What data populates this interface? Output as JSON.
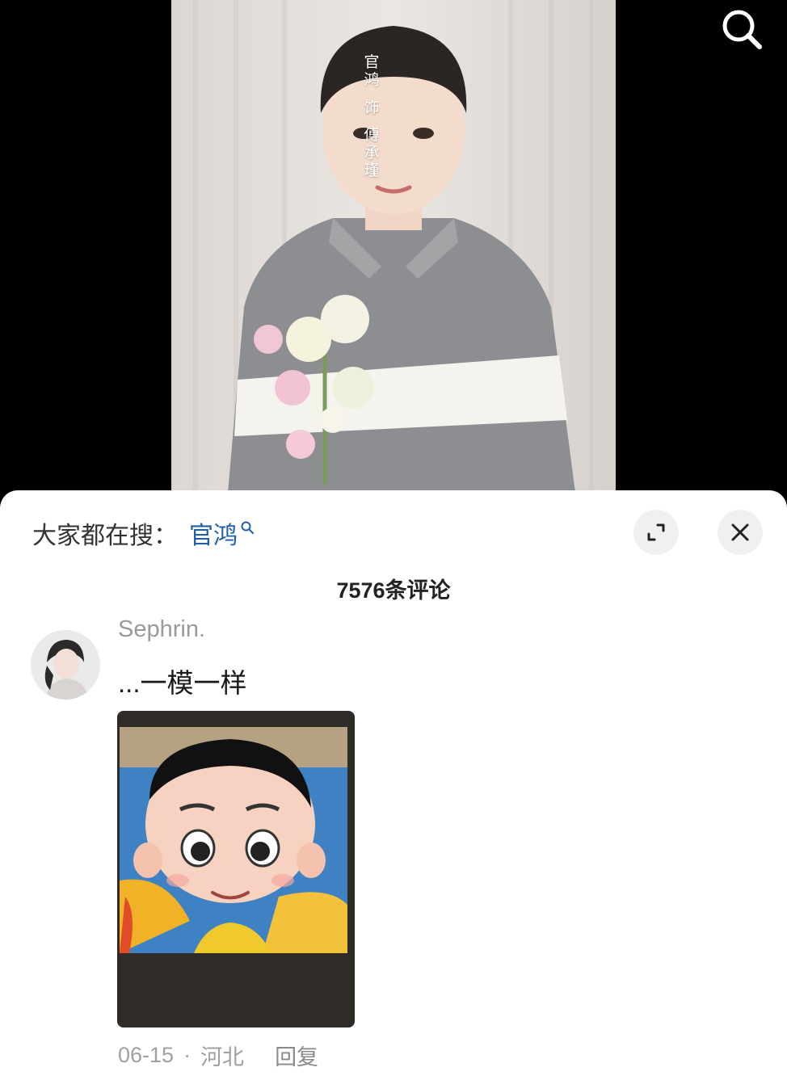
{
  "video": {
    "caption_lines": [
      "官",
      "鸿",
      "饰",
      "傅",
      "承",
      "瑾"
    ],
    "search_icon": "search-icon"
  },
  "sheet": {
    "hot_search_label": "大家都在搜：",
    "hot_search_term": "官鸿",
    "hot_search_icon": "search-icon",
    "expand_icon": "expand-icon",
    "close_icon": "close-icon",
    "comment_count": "7576条评论"
  },
  "comment": {
    "username": "Sephrin.",
    "text": "...一模一样",
    "date": "06-15",
    "separator": "·",
    "location": "河北",
    "reply_label": "回复"
  },
  "colors": {
    "link": "#1f5fa8",
    "sheet_bg": "#ffffff",
    "button_bg": "#f0f0f0",
    "meta_text": "#a0a0a0"
  }
}
